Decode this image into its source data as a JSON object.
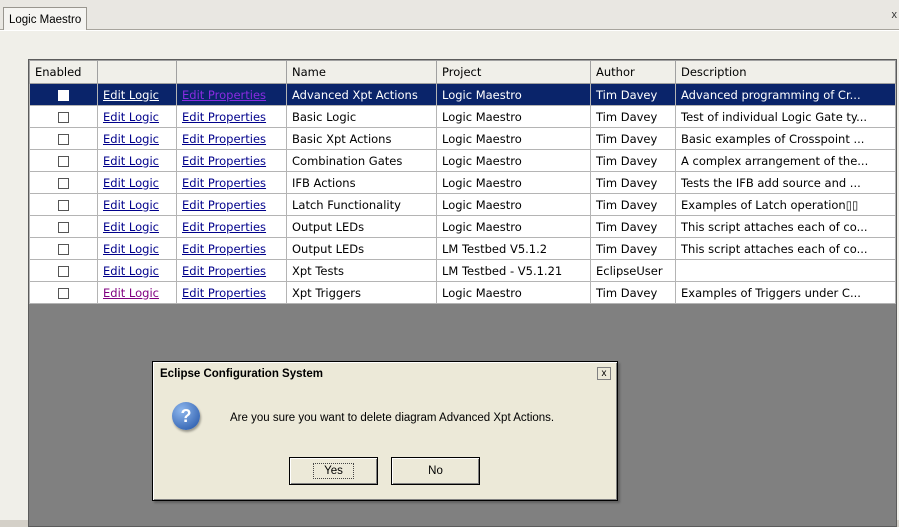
{
  "tab": {
    "label": "Logic Maestro",
    "close": "x"
  },
  "table": {
    "columns": [
      "Enabled",
      "",
      "",
      "Name",
      "Project",
      "Author",
      "Description"
    ],
    "rows": [
      {
        "edit_logic": "Edit Logic",
        "edit_props": "Edit Properties",
        "name": "Advanced Xpt Actions",
        "project": "Logic Maestro",
        "author": "Tim Davey",
        "description": "Advanced programming of Cr..."
      },
      {
        "edit_logic": "Edit Logic",
        "edit_props": "Edit Properties",
        "name": "Basic Logic",
        "project": "Logic Maestro",
        "author": "Tim Davey",
        "description": "Test of individual Logic Gate ty..."
      },
      {
        "edit_logic": "Edit Logic",
        "edit_props": "Edit Properties",
        "name": "Basic Xpt Actions",
        "project": "Logic Maestro",
        "author": "Tim Davey",
        "description": "Basic examples of Crosspoint ..."
      },
      {
        "edit_logic": "Edit Logic",
        "edit_props": "Edit Properties",
        "name": "Combination Gates",
        "project": "Logic Maestro",
        "author": "Tim Davey",
        "description": "A complex arrangement of the..."
      },
      {
        "edit_logic": "Edit Logic",
        "edit_props": "Edit Properties",
        "name": "IFB Actions",
        "project": "Logic Maestro",
        "author": "Tim Davey",
        "description": "Tests the IFB add source and ..."
      },
      {
        "edit_logic": "Edit Logic",
        "edit_props": "Edit Properties",
        "name": "Latch Functionality",
        "project": "Logic Maestro",
        "author": "Tim Davey",
        "description": "Examples of Latch operation▯▯"
      },
      {
        "edit_logic": "Edit Logic",
        "edit_props": "Edit Properties",
        "name": "Output LEDs",
        "project": "Logic Maestro",
        "author": "Tim Davey",
        "description": "This script attaches each of co..."
      },
      {
        "edit_logic": "Edit Logic",
        "edit_props": "Edit Properties",
        "name": "Output LEDs",
        "project": "LM Testbed V5.1.2",
        "author": "Tim Davey",
        "description": "This script attaches each of co..."
      },
      {
        "edit_logic": "Edit Logic",
        "edit_props": "Edit Properties",
        "name": "Xpt Tests",
        "project": "LM Testbed - V5.1.21",
        "author": "EclipseUser",
        "description": ""
      },
      {
        "edit_logic": "Edit Logic",
        "edit_props": "Edit Properties",
        "name": "Xpt Triggers",
        "project": "Logic Maestro",
        "author": "Tim Davey",
        "description": "Examples of Triggers under C..."
      }
    ]
  },
  "dialog": {
    "title": "Eclipse Configuration System",
    "close": "x",
    "icon": "question-icon",
    "icon_glyph": "?",
    "message": "Are you sure you want to delete diagram Advanced Xpt Actions.",
    "yes": "Yes",
    "no": "No"
  },
  "colors": {
    "selection": "#0a246a",
    "link": "#00008b",
    "visited_link": "#800080",
    "grid_background": "#808080"
  }
}
